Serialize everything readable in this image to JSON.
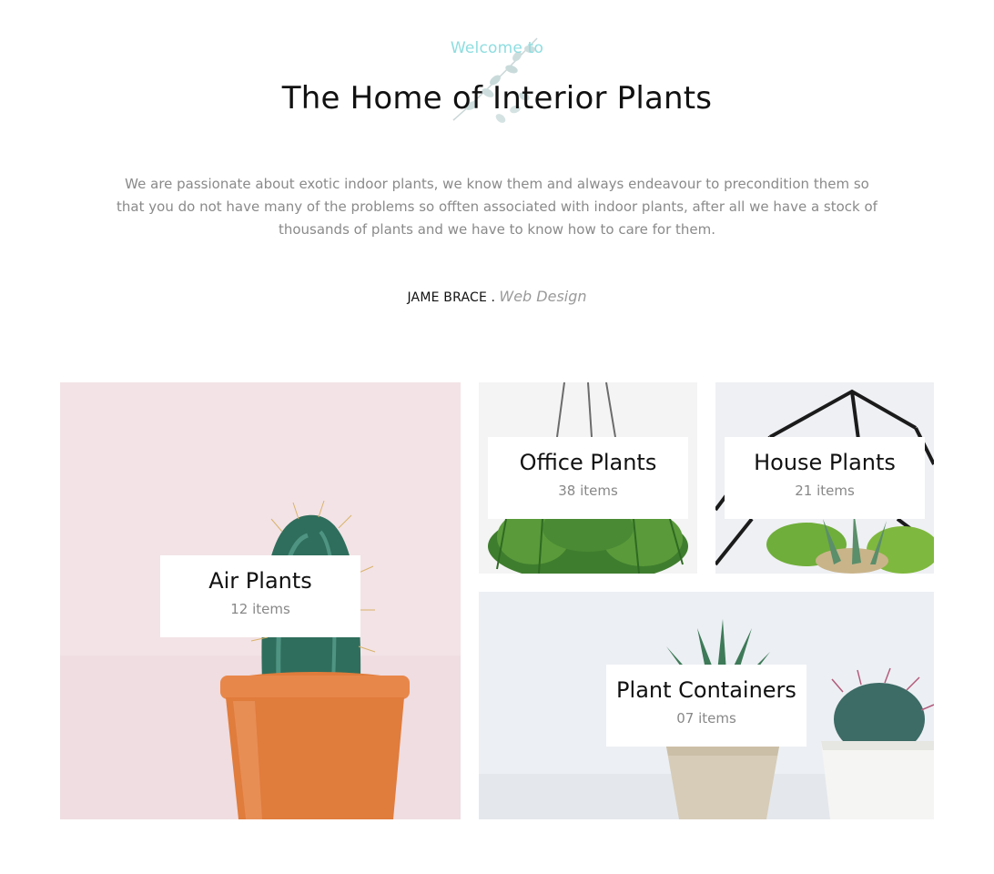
{
  "intro": {
    "eyebrow": "Welcome to",
    "title": "The Home of Interior Plants",
    "description": "We are passionate about exotic indoor plants, we know them and always endeavour to precondition them so that you do not have many of the problems so offten associated with indoor plants, after all we have a stock of thousands of plants and we have to know how to care for them.",
    "author": "JAME BRACE",
    "separator": ".",
    "role": "Web Design"
  },
  "categories": [
    {
      "name": "Air Plants",
      "count": "12 items",
      "image": "cactus-in-orange-pot"
    },
    {
      "name": "Office Plants",
      "count": "38 items",
      "image": "hanging-fern"
    },
    {
      "name": "House Plants",
      "count": "21 items",
      "image": "terrarium-succulents"
    },
    {
      "name": "Plant Containers",
      "count": "07 items",
      "image": "succulent-pots"
    }
  ],
  "colors": {
    "eyebrow": "#8edde0",
    "description": "#8a8a8a",
    "count": "#888888",
    "pot": "#e07c3c",
    "leaf": "#2f6e5c"
  }
}
